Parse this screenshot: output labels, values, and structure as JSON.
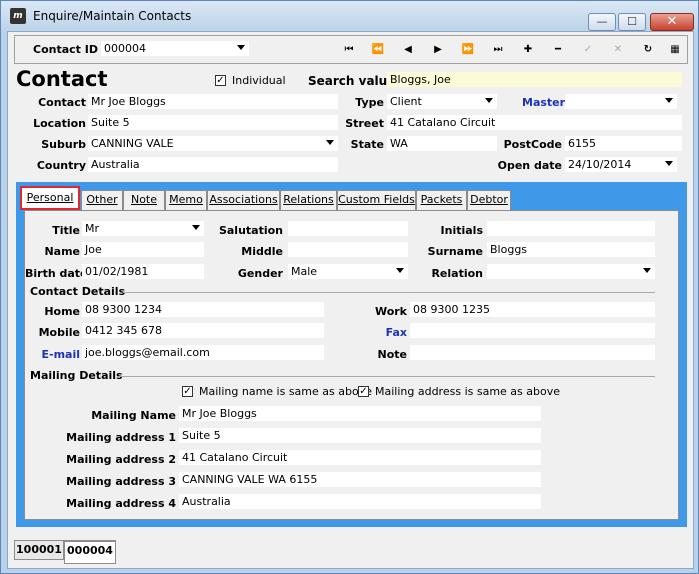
{
  "window": {
    "title": "Enquire/Maintain Contacts",
    "min_glyph": "—",
    "max_glyph": "☐",
    "close_glyph": "✕"
  },
  "toolbar": {
    "contact_id_label": "Contact ID",
    "contact_id_value": "000004",
    "nav": [
      "⏮",
      "⏪",
      "◀",
      "▶",
      "⏩",
      "⏭",
      "✚",
      "━",
      "✓",
      "✕",
      "↻",
      "▦"
    ]
  },
  "header": {
    "heading": "Contact",
    "individual_label": "Individual",
    "individual_checked": true,
    "search_label": "Search value",
    "search_value": "Bloggs, Joe",
    "contact_label": "Contact",
    "contact_value": "Mr Joe Bloggs",
    "type_label": "Type",
    "type_value": "Client",
    "master_label": "Master",
    "master_value": "",
    "location_label": "Location",
    "location_value": "Suite 5",
    "street_label": "Street",
    "street_value": "41 Catalano Circuit",
    "suburb_label": "Suburb",
    "suburb_value": "CANNING VALE",
    "state_label": "State",
    "state_value": "WA",
    "postcode_label": "PostCode",
    "postcode_value": "6155",
    "country_label": "Country",
    "country_value": "Australia",
    "open_date_label": "Open date",
    "open_date_value": "24/10/2014"
  },
  "tabs": [
    "Personal",
    "Other",
    "Note",
    "Memo",
    "Associations",
    "Relations",
    "Custom Fields",
    "Packets",
    "Debtor"
  ],
  "personal": {
    "title_label": "Title",
    "title_value": "Mr",
    "salutation_label": "Salutation",
    "salutation_value": "",
    "initials_label": "Initials",
    "initials_value": "",
    "name_label": "Name",
    "name_value": "Joe",
    "middle_label": "Middle",
    "middle_value": "",
    "surname_label": "Surname",
    "surname_value": "Bloggs",
    "birth_label": "Birth date",
    "birth_value": "01/02/1981",
    "gender_label": "Gender",
    "gender_value": "Male",
    "relation_label": "Relation",
    "relation_value": "",
    "contact_details_label": "Contact Details",
    "home_label": "Home",
    "home_value": "08 9300 1234",
    "work_label": "Work",
    "work_value": "08 9300 1235",
    "mobile_label": "Mobile",
    "mobile_value": "0412 345 678",
    "fax_label": "Fax",
    "fax_value": "",
    "email_label": "E-mail",
    "email_value": "joe.bloggs@email.com",
    "note_label": "Note",
    "note_value": "",
    "mailing_details_label": "Mailing Details",
    "same_name_label": "Mailing name is same as above",
    "same_address_label": "Mailing address is same as above",
    "mailing_name_label": "Mailing Name",
    "mailing_name_value": "Mr Joe Bloggs",
    "addr1_label": "Mailing address 1",
    "addr1_value": "Suite 5",
    "addr2_label": "Mailing address 2",
    "addr2_value": "41 Catalano Circuit",
    "addr3_label": "Mailing address 3",
    "addr3_value": "CANNING VALE WA 6155",
    "addr4_label": "Mailing address 4",
    "addr4_value": "Australia"
  },
  "bottom_tabs": [
    "100001",
    "000004"
  ],
  "colors": {
    "tab_strip": "#3f98e8",
    "active_tab_border": "#e0282e",
    "link_label": "#1c34b4",
    "search_field": "#fbfbd8"
  }
}
